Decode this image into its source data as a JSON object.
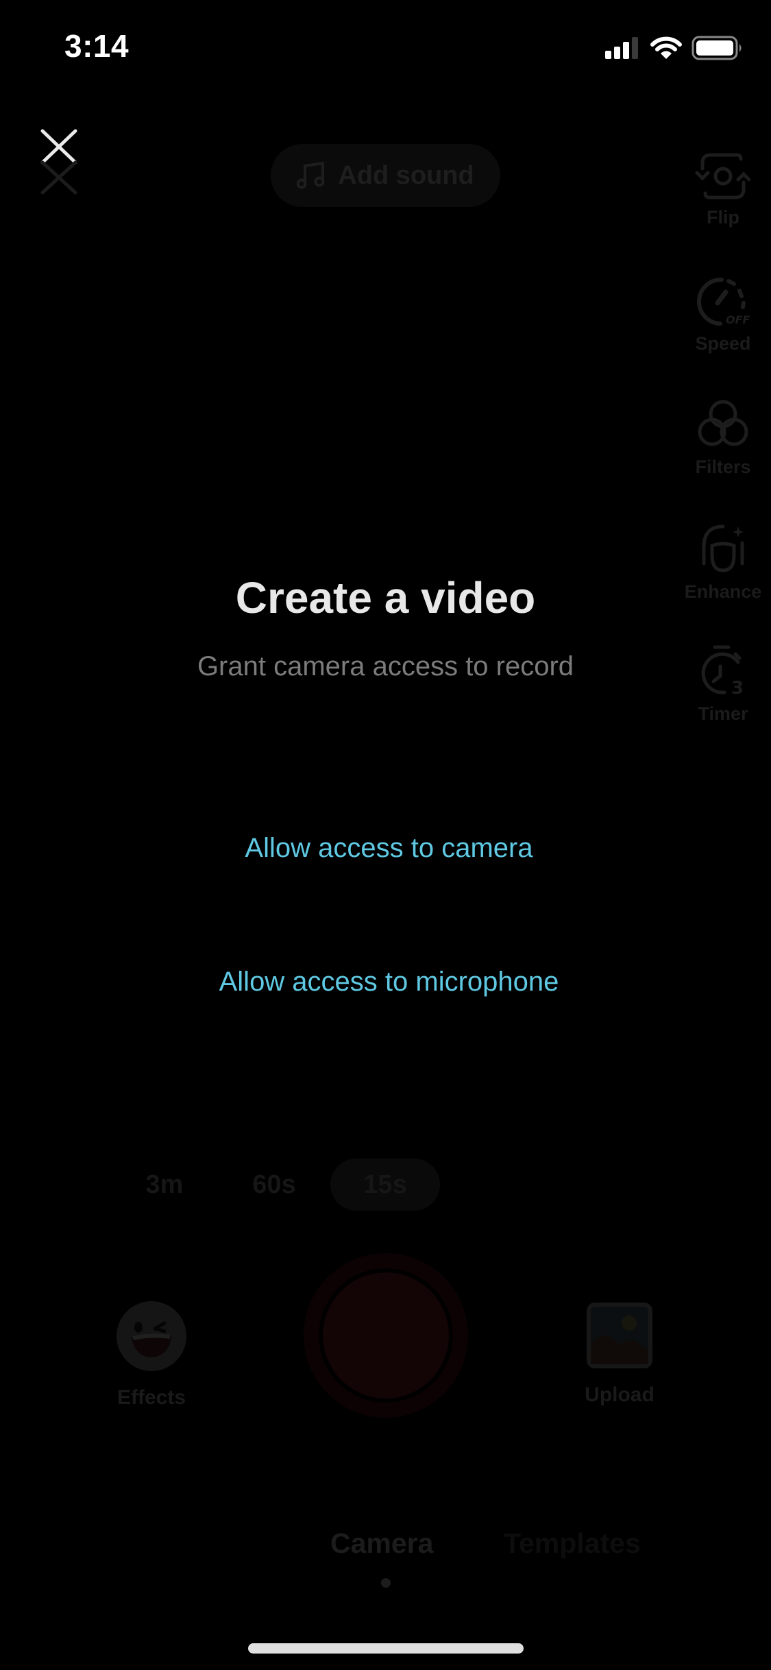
{
  "status_bar": {
    "time": "3:14",
    "signal_bars_active": 3,
    "signal_bars_total": 4,
    "wifi": "wifi-icon",
    "battery": "battery-full-icon"
  },
  "top": {
    "close_icon": "close-icon",
    "add_sound": {
      "label": "Add sound",
      "icon": "music-note-icon"
    }
  },
  "right_rail": [
    {
      "label": "Flip",
      "icon": "flip-camera-icon"
    },
    {
      "label": "Speed",
      "icon": "speed-off-icon",
      "badge": "OFF"
    },
    {
      "label": "Filters",
      "icon": "filters-icon"
    },
    {
      "label": "Enhance",
      "icon": "enhance-icon"
    },
    {
      "label": "Timer",
      "icon": "timer-icon",
      "badge": "3"
    }
  ],
  "permission": {
    "title": "Create a video",
    "subtitle": "Grant camera access to record",
    "allow_camera": "Allow access to camera",
    "allow_microphone": "Allow access to microphone"
  },
  "durations": {
    "options": [
      "3m",
      "60s",
      "15s"
    ],
    "selected": "15s"
  },
  "bottom": {
    "effects_label": "Effects",
    "upload_label": "Upload",
    "record_icon": "record-button"
  },
  "modes": {
    "items": [
      "Camera",
      "Templates"
    ],
    "selected": "Camera"
  },
  "colors": {
    "link": "#5fc9e3",
    "title": "#e8e8e8",
    "subtitle": "#7c7c7c",
    "background": "#000000"
  }
}
